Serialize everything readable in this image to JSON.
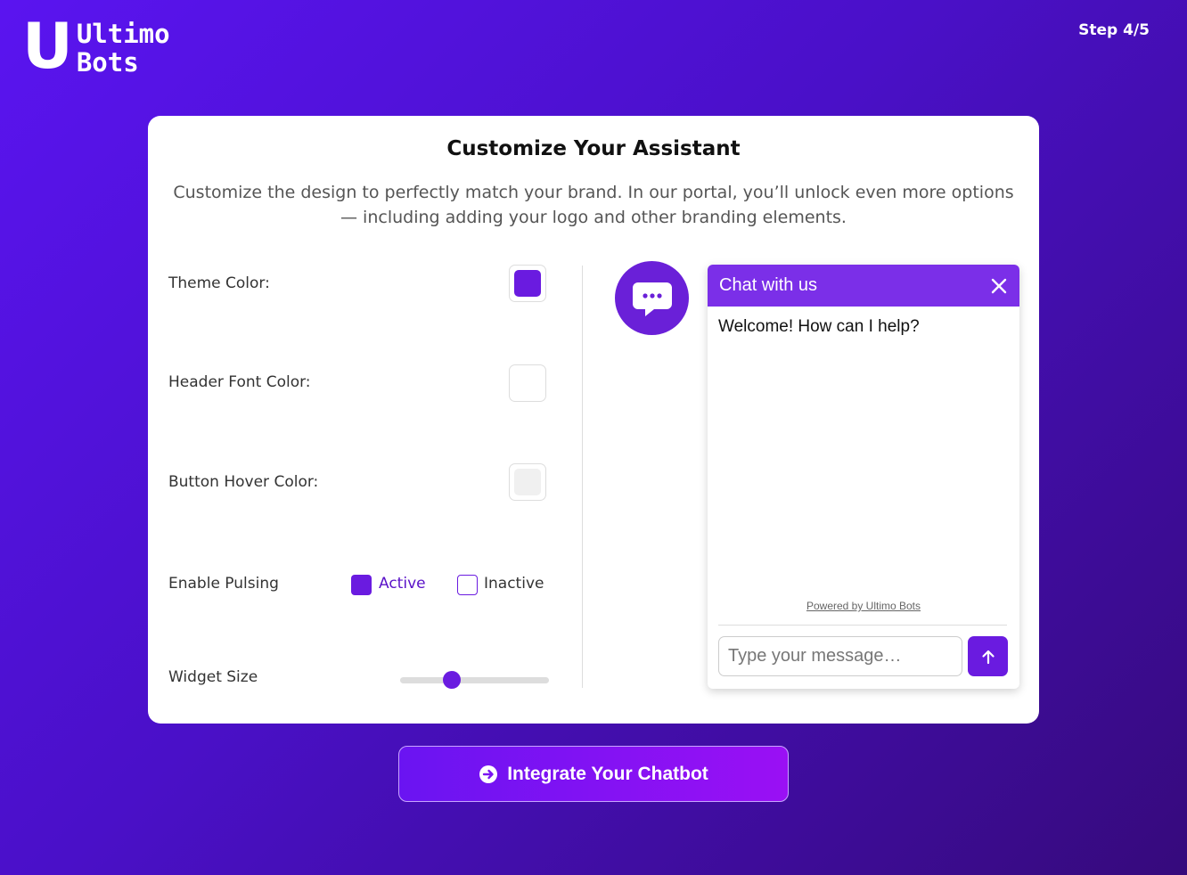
{
  "brand": {
    "letter": "U",
    "line1": "Ultimo",
    "line2": "Bots"
  },
  "step": "Step 4/5",
  "card": {
    "title": "Customize Your Assistant",
    "subtitle": "Customize the design to perfectly match your brand. In our portal, you’ll unlock even more options — including adding your logo and other branding elements."
  },
  "options": {
    "theme_color": {
      "label": "Theme Color:",
      "value": "#6a1be0"
    },
    "header_font_color": {
      "label": "Header Font Color:",
      "value": "#ffffff"
    },
    "button_hover_color": {
      "label": "Button Hover Color:",
      "value": "#f0f0f0"
    },
    "pulsing": {
      "label": "Enable Pulsing",
      "active_label": "Active",
      "inactive_label": "Inactive",
      "selected": "Active"
    },
    "widget_size": {
      "label": "Widget Size",
      "fraction": 0.35
    }
  },
  "chat": {
    "header_title": "Chat with us",
    "welcome": "Welcome! How can I help?",
    "powered_by": "Powered by Ultimo Bots",
    "input_placeholder": "Type your message…",
    "accent": "#7b2fe8"
  },
  "cta": {
    "label": "Integrate Your Chatbot",
    "icon": "arrow-circle-right-icon"
  }
}
